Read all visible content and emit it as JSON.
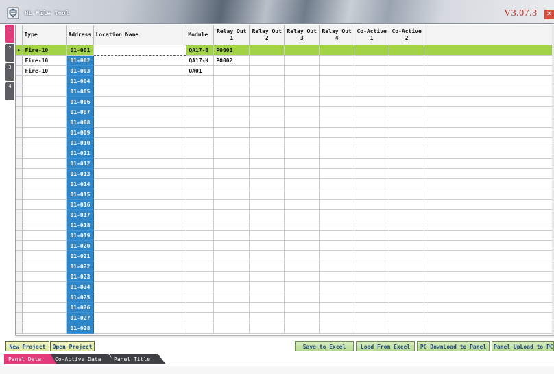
{
  "app": {
    "title": "HL File Tool",
    "version": "V3.07.3"
  },
  "side_tabs": [
    "1",
    "2",
    "3",
    "4"
  ],
  "columns": [
    "Type",
    "Address",
    "Location Name",
    "Module",
    "Relay Out 1",
    "Relay Out 2",
    "Relay Out 3",
    "Relay Out 4",
    "Co-Active 1",
    "Co-Active 2"
  ],
  "columns_split": [
    [
      "Type",
      ""
    ],
    [
      "Address",
      ""
    ],
    [
      "Location Name",
      ""
    ],
    [
      "Module",
      ""
    ],
    [
      "Relay Out",
      "1"
    ],
    [
      "Relay Out",
      "2"
    ],
    [
      "Relay Out",
      "3"
    ],
    [
      "Relay Out",
      "4"
    ],
    [
      "Co-Active",
      "1"
    ],
    [
      "Co-Active",
      "2"
    ]
  ],
  "selected_row_marker": "▶",
  "rows": [
    {
      "type": "Fire-10",
      "address": "01-001",
      "location": "",
      "module": "QA17-B",
      "r1": "P0001",
      "r2": "",
      "r3": "",
      "r4": "",
      "c1": "",
      "c2": ""
    },
    {
      "type": "Fire-10",
      "address": "01-002",
      "location": "",
      "module": "QA17-K",
      "r1": "P0002",
      "r2": "",
      "r3": "",
      "r4": "",
      "c1": "",
      "c2": ""
    },
    {
      "type": "Fire-10",
      "address": "01-003",
      "location": "",
      "module": "QA01",
      "r1": "",
      "r2": "",
      "r3": "",
      "r4": "",
      "c1": "",
      "c2": ""
    },
    {
      "type": "",
      "address": "01-004",
      "location": "",
      "module": "",
      "r1": "",
      "r2": "",
      "r3": "",
      "r4": "",
      "c1": "",
      "c2": ""
    },
    {
      "type": "",
      "address": "01-005",
      "location": "",
      "module": "",
      "r1": "",
      "r2": "",
      "r3": "",
      "r4": "",
      "c1": "",
      "c2": ""
    },
    {
      "type": "",
      "address": "01-006",
      "location": "",
      "module": "",
      "r1": "",
      "r2": "",
      "r3": "",
      "r4": "",
      "c1": "",
      "c2": ""
    },
    {
      "type": "",
      "address": "01-007",
      "location": "",
      "module": "",
      "r1": "",
      "r2": "",
      "r3": "",
      "r4": "",
      "c1": "",
      "c2": ""
    },
    {
      "type": "",
      "address": "01-008",
      "location": "",
      "module": "",
      "r1": "",
      "r2": "",
      "r3": "",
      "r4": "",
      "c1": "",
      "c2": ""
    },
    {
      "type": "",
      "address": "01-009",
      "location": "",
      "module": "",
      "r1": "",
      "r2": "",
      "r3": "",
      "r4": "",
      "c1": "",
      "c2": ""
    },
    {
      "type": "",
      "address": "01-010",
      "location": "",
      "module": "",
      "r1": "",
      "r2": "",
      "r3": "",
      "r4": "",
      "c1": "",
      "c2": ""
    },
    {
      "type": "",
      "address": "01-011",
      "location": "",
      "module": "",
      "r1": "",
      "r2": "",
      "r3": "",
      "r4": "",
      "c1": "",
      "c2": ""
    },
    {
      "type": "",
      "address": "01-012",
      "location": "",
      "module": "",
      "r1": "",
      "r2": "",
      "r3": "",
      "r4": "",
      "c1": "",
      "c2": ""
    },
    {
      "type": "",
      "address": "01-013",
      "location": "",
      "module": "",
      "r1": "",
      "r2": "",
      "r3": "",
      "r4": "",
      "c1": "",
      "c2": ""
    },
    {
      "type": "",
      "address": "01-014",
      "location": "",
      "module": "",
      "r1": "",
      "r2": "",
      "r3": "",
      "r4": "",
      "c1": "",
      "c2": ""
    },
    {
      "type": "",
      "address": "01-015",
      "location": "",
      "module": "",
      "r1": "",
      "r2": "",
      "r3": "",
      "r4": "",
      "c1": "",
      "c2": ""
    },
    {
      "type": "",
      "address": "01-016",
      "location": "",
      "module": "",
      "r1": "",
      "r2": "",
      "r3": "",
      "r4": "",
      "c1": "",
      "c2": ""
    },
    {
      "type": "",
      "address": "01-017",
      "location": "",
      "module": "",
      "r1": "",
      "r2": "",
      "r3": "",
      "r4": "",
      "c1": "",
      "c2": ""
    },
    {
      "type": "",
      "address": "01-018",
      "location": "",
      "module": "",
      "r1": "",
      "r2": "",
      "r3": "",
      "r4": "",
      "c1": "",
      "c2": ""
    },
    {
      "type": "",
      "address": "01-019",
      "location": "",
      "module": "",
      "r1": "",
      "r2": "",
      "r3": "",
      "r4": "",
      "c1": "",
      "c2": ""
    },
    {
      "type": "",
      "address": "01-020",
      "location": "",
      "module": "",
      "r1": "",
      "r2": "",
      "r3": "",
      "r4": "",
      "c1": "",
      "c2": ""
    },
    {
      "type": "",
      "address": "01-021",
      "location": "",
      "module": "",
      "r1": "",
      "r2": "",
      "r3": "",
      "r4": "",
      "c1": "",
      "c2": ""
    },
    {
      "type": "",
      "address": "01-022",
      "location": "",
      "module": "",
      "r1": "",
      "r2": "",
      "r3": "",
      "r4": "",
      "c1": "",
      "c2": ""
    },
    {
      "type": "",
      "address": "01-023",
      "location": "",
      "module": "",
      "r1": "",
      "r2": "",
      "r3": "",
      "r4": "",
      "c1": "",
      "c2": ""
    },
    {
      "type": "",
      "address": "01-024",
      "location": "",
      "module": "",
      "r1": "",
      "r2": "",
      "r3": "",
      "r4": "",
      "c1": "",
      "c2": ""
    },
    {
      "type": "",
      "address": "01-025",
      "location": "",
      "module": "",
      "r1": "",
      "r2": "",
      "r3": "",
      "r4": "",
      "c1": "",
      "c2": ""
    },
    {
      "type": "",
      "address": "01-026",
      "location": "",
      "module": "",
      "r1": "",
      "r2": "",
      "r3": "",
      "r4": "",
      "c1": "",
      "c2": ""
    },
    {
      "type": "",
      "address": "01-027",
      "location": "",
      "module": "",
      "r1": "",
      "r2": "",
      "r3": "",
      "r4": "",
      "c1": "",
      "c2": ""
    },
    {
      "type": "",
      "address": "01-028",
      "location": "",
      "module": "",
      "r1": "",
      "r2": "",
      "r3": "",
      "r4": "",
      "c1": "",
      "c2": ""
    }
  ],
  "buttons": {
    "new_project": "New Project",
    "open_project": "Open Project",
    "save_to_excel": "Save to Excel",
    "load_from_excel": "Load From Excel",
    "pc_download": "PC DownLoad to Panel",
    "panel_upload": "Panel UpLoad to PC"
  },
  "bottom_tabs": [
    "Panel Data",
    "Co-Active Data",
    "Panel Title"
  ],
  "colors": {
    "accent_tab": "#e23a7a",
    "address_col": "#2f86c8",
    "selected_row": "#a2d246",
    "version_text": "#c0291c"
  },
  "icons": {
    "app": "app-logo-icon",
    "close": "close-icon",
    "row_pointer": "row-pointer-icon"
  }
}
